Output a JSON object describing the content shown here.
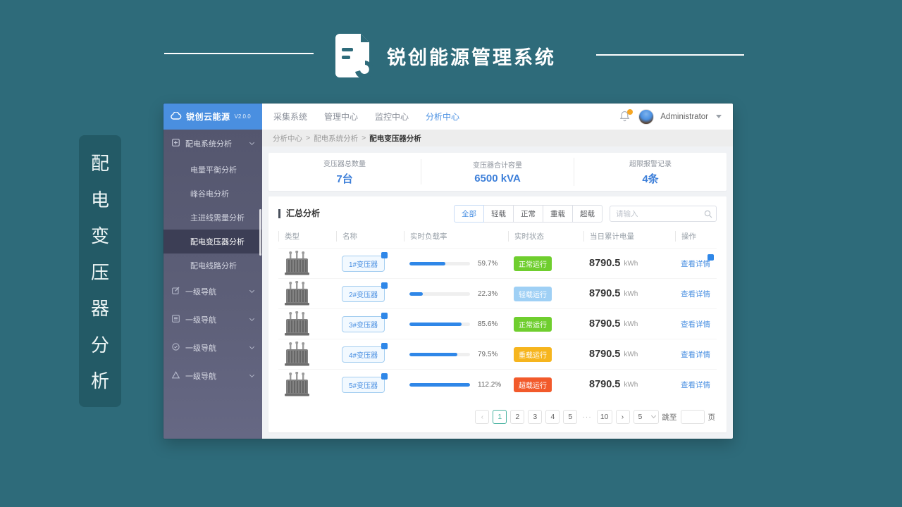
{
  "brand": {
    "title": "锐创能源管理系统",
    "tag_chars": [
      "配",
      "电",
      "变",
      "压",
      "器",
      "分",
      "析"
    ],
    "bg_color": "#2e6b7a",
    "accent_color": "#4a90e2"
  },
  "sidebar": {
    "logo_text": "锐创云能源",
    "version": "V2.0.0",
    "root_item": "配电系统分析",
    "sub_items": [
      "电量平衡分析",
      "峰谷电分析",
      "主进线需量分析",
      "配电变压器分析",
      "配电线路分析"
    ],
    "active_sub": "配电变压器分析",
    "nav_items": [
      "一级导航",
      "一级导航",
      "一级导航",
      "一级导航"
    ]
  },
  "topnav": {
    "items": [
      "采集系统",
      "管理中心",
      "监控中心",
      "分析中心"
    ],
    "active": "分析中心",
    "username": "Administrator"
  },
  "breadcrumb": {
    "items": [
      "分析中心",
      "配电系统分析",
      "配电变压器分析"
    ],
    "separator": ">"
  },
  "stats": {
    "cards": [
      {
        "label": "变压器总数量",
        "value": "7台"
      },
      {
        "label": "变压器合计容量",
        "value": "6500 kVA"
      },
      {
        "label": "超限报警记录",
        "value": "4条"
      }
    ]
  },
  "summary": {
    "title": "汇总分析",
    "filters": [
      "全部",
      "轻载",
      "正常",
      "重载",
      "超载"
    ],
    "active_filter": "全部",
    "search_placeholder": "请输入",
    "columns": [
      "类型",
      "名称",
      "实时负载率",
      "实时状态",
      "当日累计电量",
      "操作"
    ],
    "action_label": "查看详情",
    "energy_unit": "kWh",
    "rows": [
      {
        "name": "1#变压器",
        "load": "59.7%",
        "load_value": 59.7,
        "status": "正常运行",
        "status_color": "#6fce2e",
        "energy": "8790.5"
      },
      {
        "name": "2#变压器",
        "load": "22.3%",
        "load_value": 22.3,
        "status": "轻载运行",
        "status_color": "#9fd0f5",
        "energy": "8790.5"
      },
      {
        "name": "3#变压器",
        "load": "85.6%",
        "load_value": 85.6,
        "status": "正常运行",
        "status_color": "#6fce2e",
        "energy": "8790.5"
      },
      {
        "name": "4#变压器",
        "load": "79.5%",
        "load_value": 79.5,
        "status": "重载运行",
        "status_color": "#f6b51e",
        "energy": "8790.5"
      },
      {
        "name": "5#变压器",
        "load": "112.2%",
        "load_value": 112.2,
        "status": "超载运行",
        "status_color": "#f25a2b",
        "energy": "8790.5"
      }
    ]
  },
  "pagination": {
    "prev": "‹",
    "pages": [
      "1",
      "2",
      "3",
      "4",
      "5"
    ],
    "ellipsis": "···",
    "last": "10",
    "next": "›",
    "active_page": "1",
    "page_size": "5",
    "jump_label": "跳至",
    "page_label": "页"
  }
}
